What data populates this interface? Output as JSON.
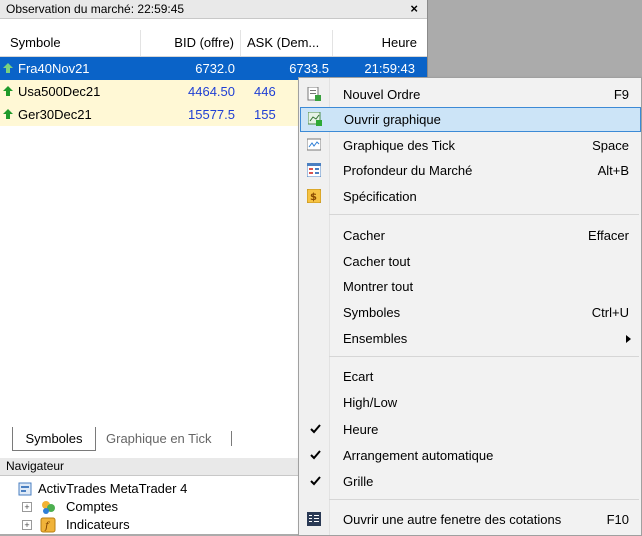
{
  "market_watch": {
    "title": "Observation du marché: 22:59:45",
    "close": "×",
    "columns": [
      "Symbole",
      "BID (offre)",
      "ASK (Dem...",
      "Heure"
    ],
    "rows": [
      {
        "symbol": "Fra40Nov21",
        "bid": "6732.0",
        "ask": "6733.5",
        "time": "21:59:43",
        "selected": true
      },
      {
        "symbol": "Usa500Dec21",
        "bid": "4464.50",
        "ask": "446"
      },
      {
        "symbol": "Ger30Dec21",
        "bid": "15577.5",
        "ask": "155"
      }
    ],
    "tabs": [
      "Symboles",
      "Graphique en Tick"
    ]
  },
  "navigator": {
    "title": "Navigateur",
    "items": [
      "ActivTrades MetaTrader 4",
      "Comptes",
      "Indicateurs"
    ]
  },
  "context_menu": {
    "items": [
      {
        "label": "Nouvel Ordre",
        "shortcut": "F9",
        "icon": "new-order-icon"
      },
      {
        "label": "Ouvrir graphique",
        "shortcut": "",
        "icon": "open-chart-icon",
        "highlighted": true
      },
      {
        "label": "Graphique des Tick",
        "shortcut": "Space",
        "icon": "tick-chart-icon"
      },
      {
        "label": "Profondeur du Marché",
        "shortcut": "Alt+B",
        "icon": "market-depth-icon"
      },
      {
        "label": "Spécification",
        "shortcut": "",
        "icon": "specification-icon"
      },
      {
        "label": "Cacher",
        "shortcut": "Effacer"
      },
      {
        "label": "Cacher tout",
        "shortcut": ""
      },
      {
        "label": "Montrer tout",
        "shortcut": ""
      },
      {
        "label": "Symboles",
        "shortcut": "Ctrl+U"
      },
      {
        "label": "Ensembles",
        "shortcut": "",
        "submenu": true
      },
      {
        "label": "Ecart",
        "shortcut": ""
      },
      {
        "label": "High/Low",
        "shortcut": ""
      },
      {
        "label": "Heure",
        "shortcut": "",
        "checked": true
      },
      {
        "label": "Arrangement automatique",
        "shortcut": "",
        "checked": true
      },
      {
        "label": "Grille",
        "shortcut": "",
        "checked": true
      },
      {
        "label": "Ouvrir une autre fenetre des cotations",
        "shortcut": "F10",
        "icon": "quotes-window-icon"
      }
    ]
  },
  "colors": {
    "selection": "#0a63c8",
    "highlight_bg": "#cce4f7",
    "highlight_border": "#3c8ad6",
    "row_bg": "#fff8d5",
    "bid_blue": "#1f3fd4",
    "arrow_up_green": "#1f9a2a"
  }
}
